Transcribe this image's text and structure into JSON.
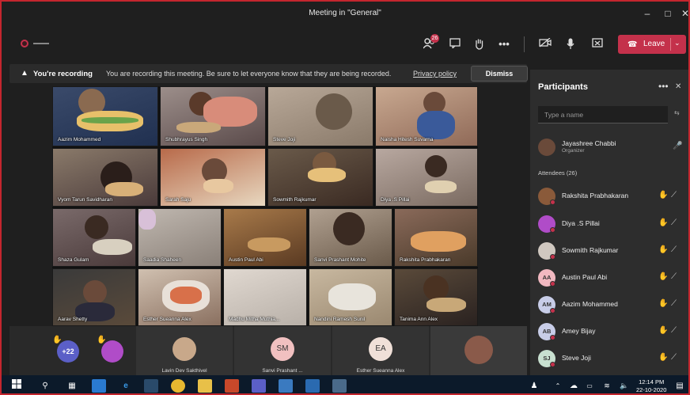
{
  "window": {
    "title": "Meeting in \"General\""
  },
  "toolbar": {
    "participants_badge": "26",
    "leave_label": "Leave"
  },
  "banner": {
    "heading": "You're recording",
    "message": "You are recording this meeting. Be sure to let everyone know that they are being recorded.",
    "link": "Privacy policy",
    "dismiss": "Dismiss"
  },
  "grid": {
    "tiles": [
      {
        "name": "Aazim Mohammed"
      },
      {
        "name": "Shubhrayus Singh"
      },
      {
        "name": "Steve Joji"
      },
      {
        "name": "Naisha Hitesh Suvarna"
      },
      {
        "name": "Vyom Tarun Savidharan"
      },
      {
        "name": "Sarah Saju"
      },
      {
        "name": "Sowmith Rajkumar"
      },
      {
        "name": "Diya .S Pillai"
      },
      {
        "name": "Shaza Gulam"
      },
      {
        "name": "Saadia Shaheen"
      },
      {
        "name": "Austin Paul Abi"
      },
      {
        "name": "Sanvi Prashant Mohite"
      },
      {
        "name": "Rakshita Prabhakaran"
      },
      {
        "name": "Aarav Shetty"
      },
      {
        "name": "Esther Sueanna Alex"
      },
      {
        "name": "Madhu Mitha Muthia..."
      },
      {
        "name": "Nandini Ramesh Sunil"
      },
      {
        "name": "Tanima Ann Alex"
      }
    ]
  },
  "strip": {
    "more_count": "+22",
    "tiles": [
      {
        "name": "Lavin Dev Sakthivel",
        "initials": ""
      },
      {
        "name": "Sanvi Prashant ...",
        "initials": "SM"
      },
      {
        "name": "Esther Sueanna Alex",
        "initials": "EA"
      }
    ]
  },
  "panel": {
    "title": "Participants",
    "search_placeholder": "Type a name",
    "organizer": {
      "name": "Jayashree Chabbi",
      "role": "Organizer"
    },
    "attendees_label": "Attendees (26)",
    "attendees": [
      {
        "name": "Rakshita Prabhakaran",
        "initials": "",
        "color": "#8a5a3a"
      },
      {
        "name": "Diya .S Pillai",
        "initials": "",
        "color": "#b04cc8"
      },
      {
        "name": "Sowmith Rajkumar",
        "initials": "",
        "color": "#d0c8c0"
      },
      {
        "name": "Austin Paul Abi",
        "initials": "AA",
        "color": "#f1b8c0"
      },
      {
        "name": "Aazim Mohammed",
        "initials": "AM",
        "color": "#c8cde8"
      },
      {
        "name": "Amey Bijay",
        "initials": "AB",
        "color": "#c8cde8"
      },
      {
        "name": "Steve Joji",
        "initials": "SJ",
        "color": "#c8e0d0"
      }
    ]
  },
  "taskbar": {
    "time": "12:14 PM",
    "date": "22-10-2020"
  },
  "colors": {
    "accent_red": "#c4314b",
    "raised_hand": "#f2c12e",
    "window_border": "#c4262e"
  }
}
